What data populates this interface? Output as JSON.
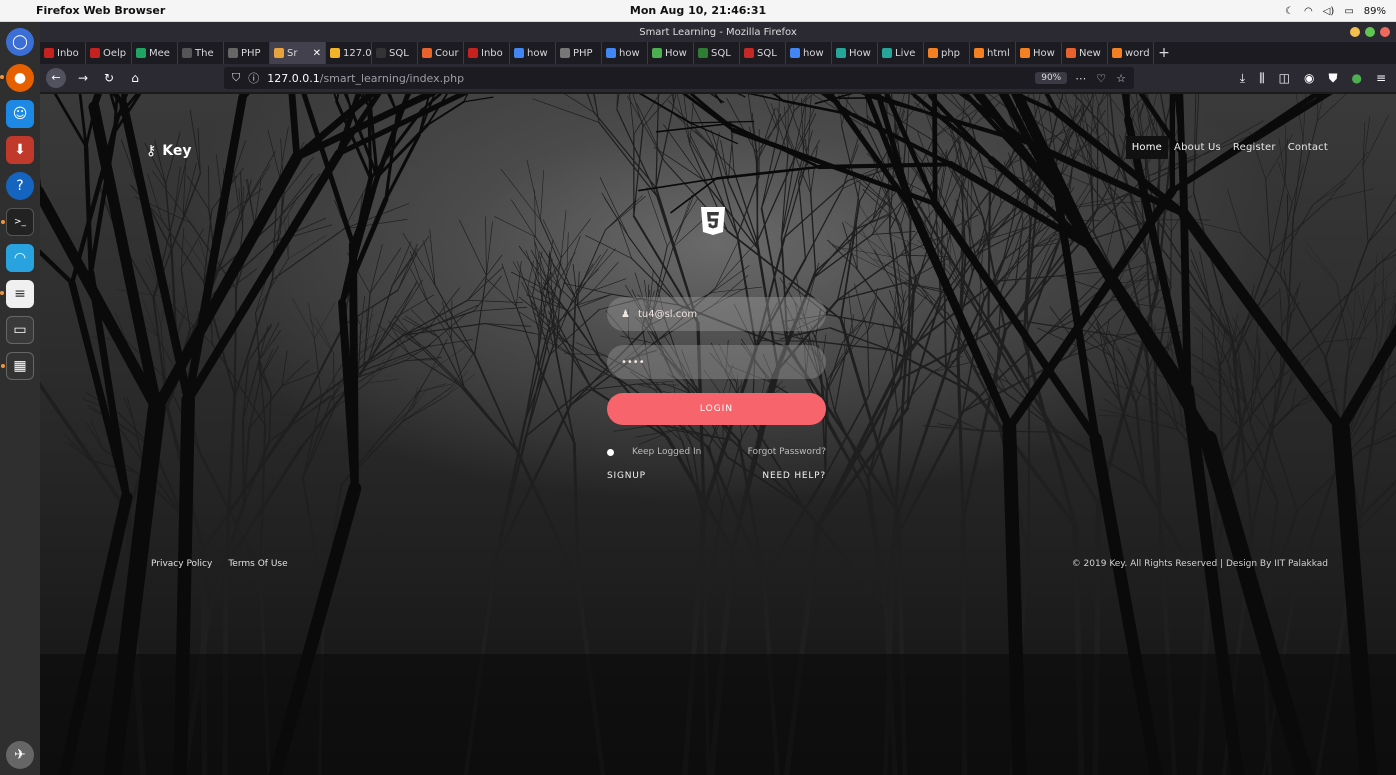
{
  "menubar": {
    "app_name": "Firefox Web Browser",
    "clock": "Mon Aug 10, 21:46:31",
    "battery": "89%"
  },
  "window": {
    "title": "Smart Learning - Mozilla Firefox"
  },
  "tabs": [
    {
      "label": "Inbo",
      "color": "#c5221f",
      "icon": "gmail-icon"
    },
    {
      "label": "Oelp",
      "color": "#c5221f",
      "icon": "gmail-icon"
    },
    {
      "label": "Mee",
      "color": "#1fa463",
      "icon": "meet-icon"
    },
    {
      "label": "The",
      "color": "#555",
      "icon": "news-icon"
    },
    {
      "label": "PHP",
      "color": "#666",
      "icon": "page-icon"
    },
    {
      "label": "Sr",
      "color": "#e8a33d",
      "icon": "page-icon",
      "active": true
    },
    {
      "label": "127.0",
      "color": "#f2b52a",
      "icon": "xampp-icon"
    },
    {
      "label": "SQL",
      "color": "#333",
      "icon": "sf-icon"
    },
    {
      "label": "Cour",
      "color": "#e8622d",
      "icon": "in-icon"
    },
    {
      "label": "Inbo",
      "color": "#c5221f",
      "icon": "gmail-icon"
    },
    {
      "label": "how",
      "color": "#4285f4",
      "icon": "google-icon"
    },
    {
      "label": "PHP",
      "color": "#777",
      "icon": "page-icon"
    },
    {
      "label": "how",
      "color": "#4285f4",
      "icon": "google-icon"
    },
    {
      "label": "How",
      "color": "#4caf50",
      "icon": "leaf-icon"
    },
    {
      "label": "SQL",
      "color": "#2e7d32",
      "icon": "sql-icon"
    },
    {
      "label": "SQL",
      "color": "#c62828",
      "icon": "do-icon"
    },
    {
      "label": "how",
      "color": "#4285f4",
      "icon": "google-icon"
    },
    {
      "label": "How",
      "color": "#26a69a",
      "icon": "page-icon"
    },
    {
      "label": "Live",
      "color": "#26a69a",
      "icon": "page-icon"
    },
    {
      "label": "php",
      "color": "#f48024",
      "icon": "stackoverflow-icon"
    },
    {
      "label": "html",
      "color": "#f48024",
      "icon": "stackoverflow-icon"
    },
    {
      "label": "How",
      "color": "#f48024",
      "icon": "stackoverflow-icon"
    },
    {
      "label": "New",
      "color": "#e8622d",
      "icon": "page-icon"
    },
    {
      "label": "word",
      "color": "#f48024",
      "icon": "stackoverflow-icon"
    }
  ],
  "urlbar": {
    "host": "127.0.0.1",
    "path": "/smart_learning/index.php",
    "zoom": "90%"
  },
  "site": {
    "logo_text": "Key",
    "nav": [
      {
        "label": "Home",
        "active": true
      },
      {
        "label": "About Us",
        "active": false
      },
      {
        "label": "Register",
        "active": false
      },
      {
        "label": "Contact",
        "active": false
      }
    ],
    "login": {
      "email_value": "tu4@sl.com",
      "password_value": "••••",
      "login_label": "LOGIN",
      "keep_logged_in": "Keep Logged In",
      "forgot_password": "Forgot Password?",
      "signup": "SIGNUP",
      "need_help": "NEED HELP?"
    },
    "footer": {
      "privacy": "Privacy Policy",
      "terms": "Terms Of Use",
      "copyright": "© 2019 Key. All Rights Reserved | Design By IIT Palakkad"
    }
  },
  "colors": {
    "login_button": "#f8646c",
    "browser_chrome": "#2b2a33"
  }
}
